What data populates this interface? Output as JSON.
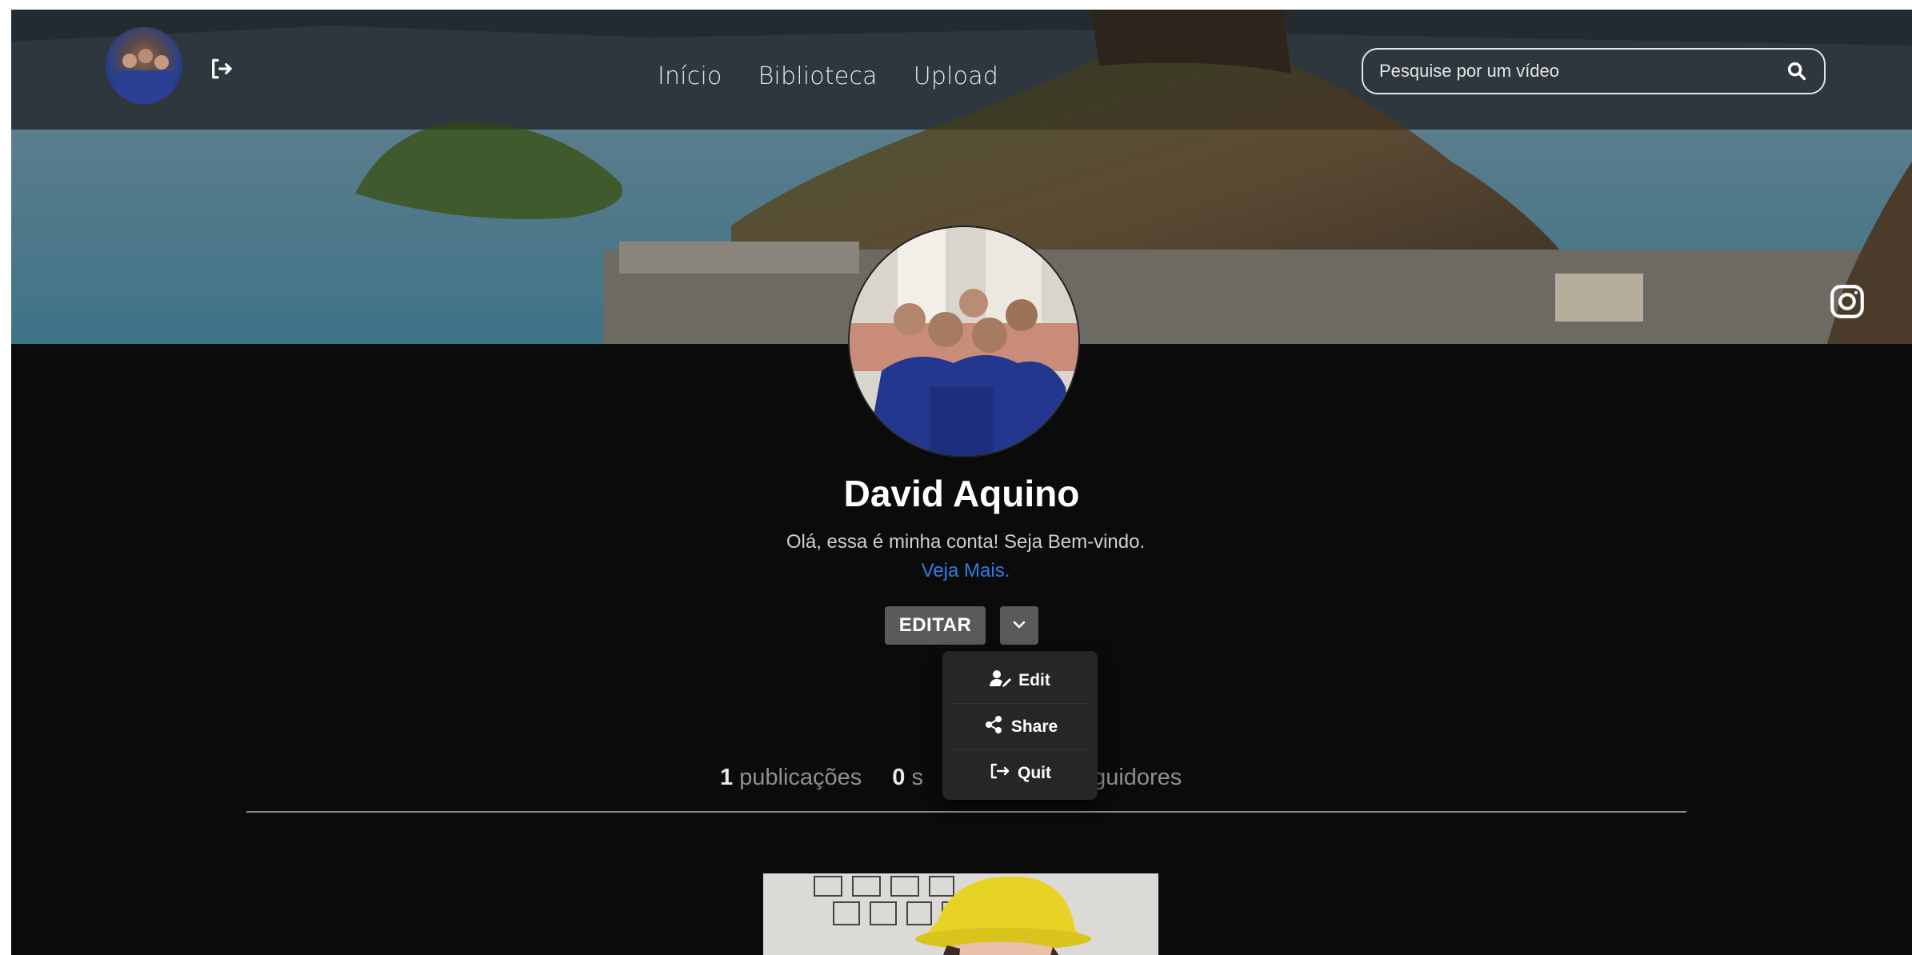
{
  "nav": {
    "items": [
      "Início",
      "Biblioteca",
      "Upload"
    ]
  },
  "search": {
    "placeholder": "Pesquise por um vídeo"
  },
  "profile": {
    "name": "David Aquino",
    "bio_text": "Olá, essa é minha conta! Seja Bem-vindo.",
    "bio_more": "Veja Mais.",
    "edit_label": "EDITAR"
  },
  "menu": {
    "items": [
      "Edit",
      "Share",
      "Quit"
    ]
  },
  "stats": {
    "posts_count": "1",
    "posts_label": "publicações",
    "following_count": "0",
    "following_label": "s",
    "followers_label": "eguidores"
  },
  "colors": {
    "background": "#0b0b0b",
    "accent_link": "#2f7de1",
    "button": "#5a5a5a",
    "menu": "#262626"
  },
  "icons": [
    "logout-icon",
    "search-icon",
    "instagram-icon",
    "chevron-down-icon",
    "user-edit-icon",
    "share-icon",
    "quit-icon"
  ]
}
